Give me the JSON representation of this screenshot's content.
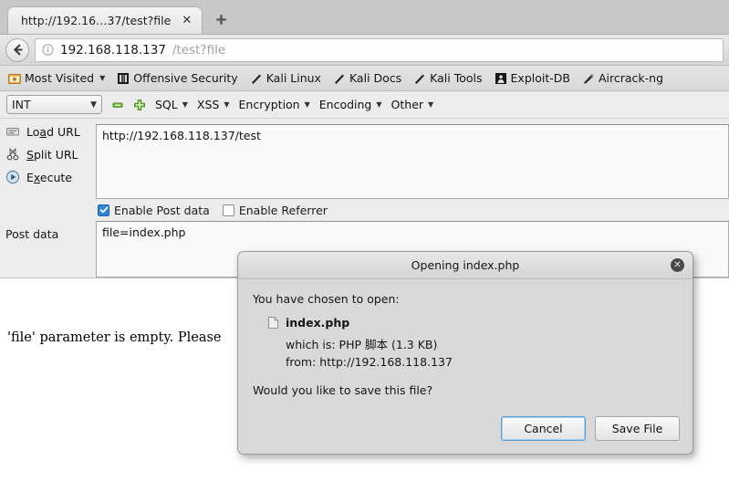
{
  "browser": {
    "tab": {
      "title": "http://192.16…37/test?file",
      "close_label": "✕",
      "new_tab_label": "+"
    },
    "nav": {
      "back_icon": "back-arrow-icon",
      "info_icon": "info-icon",
      "url_host": "192.168.118.137",
      "url_path": "/test?file"
    },
    "bookmarks": [
      {
        "label": "Most Visited",
        "icon": "folder-star-icon",
        "has_caret": true
      },
      {
        "label": "Offensive Security",
        "icon": "offsec-icon",
        "has_caret": false
      },
      {
        "label": "Kali Linux",
        "icon": "dragon-icon",
        "has_caret": false
      },
      {
        "label": "Kali Docs",
        "icon": "dragon-icon",
        "has_caret": false
      },
      {
        "label": "Kali Tools",
        "icon": "dragon-icon",
        "has_caret": false
      },
      {
        "label": "Exploit-DB",
        "icon": "exploitdb-icon",
        "has_caret": false
      },
      {
        "label": "Aircrack-ng",
        "icon": "aircrack-icon",
        "has_caret": false
      }
    ]
  },
  "hackbar": {
    "type_select": {
      "value": "INT",
      "caret": "▼"
    },
    "minus_icon": "minus-icon",
    "plus_icon": "plus-icon",
    "menus": [
      {
        "label": "SQL",
        "caret": "▼"
      },
      {
        "label": "XSS",
        "caret": "▼"
      },
      {
        "label": "Encryption",
        "caret": "▼"
      },
      {
        "label": "Encoding",
        "caret": "▼"
      },
      {
        "label": "Other",
        "caret": "▼"
      }
    ],
    "actions": [
      {
        "label": "Load URL",
        "icon": "load-url-icon",
        "accel_index": 3
      },
      {
        "label": "Split URL",
        "icon": "split-url-icon",
        "accel_index": 0
      },
      {
        "label": "Execute",
        "icon": "execute-icon",
        "accel_index": 1
      }
    ],
    "url_value": "http://192.168.118.137/test",
    "checkboxes": [
      {
        "label": "Enable Post data",
        "checked": true
      },
      {
        "label": "Enable Referrer",
        "checked": false
      }
    ],
    "post_data_label": "Post data",
    "post_data_value": "file=index.php"
  },
  "page": {
    "body_text": "'file' parameter is empty. Please"
  },
  "dialog": {
    "title": "Opening index.php",
    "close_label": "✕",
    "intro": "You have chosen to open:",
    "file_name": "index.php",
    "file_icon": "generic-file-icon",
    "which_is": "which is: PHP 脚本 (1.3 KB)",
    "from": "from: http://192.168.118.137",
    "question": "Would you like to save this file?",
    "cancel_label": "Cancel",
    "save_label": "Save File"
  },
  "colors": {
    "accent_blue": "#2b84d8",
    "chrome_bg": "#dcdcdc",
    "dialog_bg": "#d9d9d9",
    "link_gray": "#a2a2a2"
  }
}
